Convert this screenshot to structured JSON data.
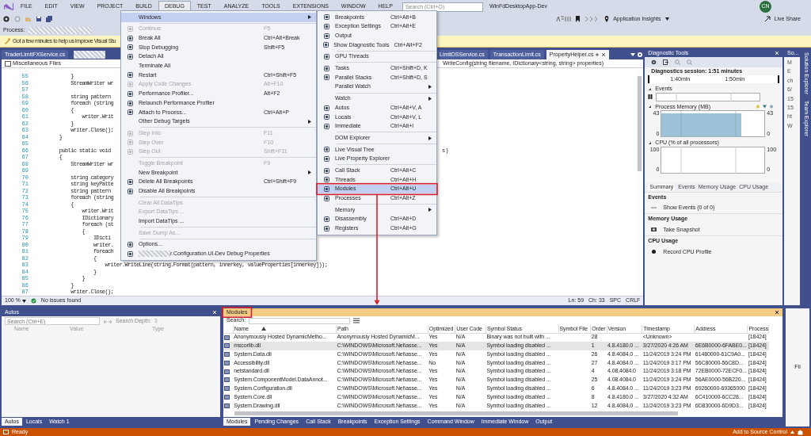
{
  "title_bar": {
    "menus": [
      {
        "label": "FILE",
        "selected": false
      },
      {
        "label": "EDIT",
        "selected": false
      },
      {
        "label": "VIEW",
        "selected": false
      },
      {
        "label": "PROJECT",
        "selected": false
      },
      {
        "label": "BUILD",
        "selected": false
      },
      {
        "label": "DEBUG",
        "selected": true
      },
      {
        "label": "TEST",
        "selected": false
      },
      {
        "label": "ANALYZE",
        "selected": false
      },
      {
        "label": "TOOLS",
        "selected": false
      },
      {
        "label": "EXTENSIONS",
        "selected": false
      },
      {
        "label": "WINDOW",
        "selected": false
      },
      {
        "label": "HELP",
        "selected": false
      }
    ],
    "search": {
      "placeholder": "Search (Ctrl+Q)"
    },
    "title": "WinFdDesktopApp-Dev",
    "user_initials": "CN",
    "live_share": "Live Share"
  },
  "toolbar": {
    "insights": "Application Insights",
    "process_label": "Process:"
  },
  "info_bar": {
    "text": "Got a few minutes to help us improve Visual Stu"
  },
  "debug_menu": {
    "items": [
      {
        "kind": "item",
        "label": "Windows",
        "submenu": true,
        "disabled": false,
        "selected": true,
        "icon": false,
        "outlined": false
      },
      {
        "kind": "separator"
      },
      {
        "kind": "item",
        "label": "Continue",
        "shortcut": "F5",
        "submenu": false,
        "disabled": true,
        "selected": false,
        "icon": true,
        "outlined": false
      },
      {
        "kind": "item",
        "label": "Break All",
        "shortcut": "Ctrl+Alt+Break",
        "submenu": false,
        "disabled": false,
        "selected": false,
        "icon": true,
        "outlined": false
      },
      {
        "kind": "item",
        "label": "Stop Debugging",
        "shortcut": "Shift+F5",
        "submenu": false,
        "disabled": false,
        "selected": false,
        "icon": true,
        "outlined": false
      },
      {
        "kind": "item",
        "label": "Detach All",
        "submenu": false,
        "disabled": false,
        "selected": false,
        "icon": true,
        "outlined": false
      },
      {
        "kind": "item",
        "label": "Terminate All",
        "submenu": false,
        "disabled": false,
        "selected": false,
        "icon": false,
        "outlined": false
      },
      {
        "kind": "item",
        "label": "Restart",
        "shortcut": "Ctrl+Shift+F5",
        "submenu": false,
        "disabled": false,
        "selected": false,
        "icon": true,
        "outlined": false
      },
      {
        "kind": "item",
        "label": "Apply Code Changes",
        "shortcut": "Alt+F10",
        "submenu": false,
        "disabled": true,
        "selected": false,
        "icon": true,
        "outlined": false
      },
      {
        "kind": "item",
        "label": "Performance Profiler...",
        "shortcut": "Alt+F2",
        "submenu": false,
        "disabled": false,
        "selected": false,
        "icon": true,
        "outlined": false
      },
      {
        "kind": "item",
        "label": "Relaunch Performance Profiler",
        "submenu": false,
        "disabled": false,
        "selected": false,
        "icon": true,
        "outlined": false
      },
      {
        "kind": "item",
        "label": "Attach to Process...",
        "shortcut": "Ctrl+Alt+P",
        "submenu": false,
        "disabled": false,
        "selected": false,
        "icon": true,
        "outlined": false
      },
      {
        "kind": "item",
        "label": "Other Debug Targets",
        "submenu": true,
        "disabled": false,
        "selected": false,
        "icon": false,
        "outlined": false
      },
      {
        "kind": "separator"
      },
      {
        "kind": "item",
        "label": "Step Into",
        "shortcut": "F11",
        "submenu": false,
        "disabled": true,
        "selected": false,
        "icon": true,
        "outlined": false
      },
      {
        "kind": "item",
        "label": "Step Over",
        "shortcut": "F10",
        "submenu": false,
        "disabled": true,
        "selected": false,
        "icon": true,
        "outlined": false
      },
      {
        "kind": "item",
        "label": "Step Out",
        "shortcut": "Shift+F11",
        "submenu": false,
        "disabled": true,
        "selected": false,
        "icon": true,
        "outlined": false
      },
      {
        "kind": "separator"
      },
      {
        "kind": "item",
        "label": "Toggle Breakpoint",
        "shortcut": "F9",
        "submenu": false,
        "disabled": true,
        "selected": false,
        "icon": false,
        "outlined": false
      },
      {
        "kind": "item",
        "label": "New Breakpoint",
        "submenu": true,
        "disabled": false,
        "selected": false,
        "icon": false,
        "outlined": false
      },
      {
        "kind": "item",
        "label": "Delete All Breakpoints",
        "shortcut": "Ctrl+Shift+F9",
        "submenu": false,
        "disabled": false,
        "selected": false,
        "icon": true,
        "outlined": false
      },
      {
        "kind": "item",
        "label": "Disable All Breakpoints",
        "submenu": false,
        "disabled": false,
        "selected": false,
        "icon": true,
        "outlined": false
      },
      {
        "kind": "separator"
      },
      {
        "kind": "item",
        "label": "Clear All DataTips",
        "submenu": false,
        "disabled": true,
        "selected": false,
        "icon": false,
        "outlined": false
      },
      {
        "kind": "item",
        "label": "Export DataTips ...",
        "submenu": false,
        "disabled": true,
        "selected": false,
        "icon": false,
        "outlined": false
      },
      {
        "kind": "item",
        "label": "Import DataTips ...",
        "submenu": false,
        "disabled": false,
        "selected": false,
        "icon": false,
        "outlined": false
      },
      {
        "kind": "separator"
      },
      {
        "kind": "item",
        "label": "Save Dump As...",
        "submenu": false,
        "disabled": true,
        "selected": false,
        "icon": false,
        "outlined": false
      },
      {
        "kind": "separator"
      },
      {
        "kind": "item",
        "label": "Options...",
        "submenu": false,
        "disabled": false,
        "selected": false,
        "icon": true,
        "outlined": false
      },
      {
        "kind": "redacted_item",
        "label": "r.Configuration.UI-Dev Debug Properties",
        "submenu": false,
        "disabled": false,
        "selected": false,
        "icon": true,
        "outlined": false
      }
    ]
  },
  "windows_menu": {
    "items": [
      {
        "kind": "item",
        "label": "Breakpoints",
        "shortcut": "Ctrl+Alt+B",
        "submenu": false,
        "disabled": false,
        "selected": false,
        "icon": true,
        "outlined": false
      },
      {
        "kind": "item",
        "label": "Exception Settings",
        "shortcut": "Ctrl+Alt+E",
        "submenu": false,
        "disabled": false,
        "selected": false,
        "icon": true,
        "outlined": false
      },
      {
        "kind": "item",
        "label": "Output",
        "submenu": false,
        "disabled": false,
        "selected": false,
        "icon": true,
        "outlined": false
      },
      {
        "kind": "item",
        "label": "Show Diagnostic Tools",
        "shortcut": "Ctrl+Alt+F2",
        "submenu": false,
        "disabled": false,
        "selected": false,
        "icon": true,
        "outlined": false
      },
      {
        "kind": "separator"
      },
      {
        "kind": "item",
        "label": "GPU Threads",
        "submenu": false,
        "disabled": false,
        "selected": false,
        "icon": true,
        "outlined": false
      },
      {
        "kind": "separator"
      },
      {
        "kind": "item",
        "label": "Tasks",
        "shortcut": "Ctrl+Shift+D, K",
        "submenu": false,
        "disabled": false,
        "selected": false,
        "icon": true,
        "outlined": false
      },
      {
        "kind": "item",
        "label": "Parallel Stacks",
        "shortcut": "Ctrl+Shift+D, S",
        "submenu": false,
        "disabled": false,
        "selected": false,
        "icon": true,
        "outlined": false
      },
      {
        "kind": "item",
        "label": "Parallel Watch",
        "submenu": true,
        "disabled": false,
        "selected": false,
        "icon": false,
        "outlined": false
      },
      {
        "kind": "separator"
      },
      {
        "kind": "item",
        "label": "Watch",
        "submenu": true,
        "disabled": false,
        "selected": false,
        "icon": false,
        "outlined": false
      },
      {
        "kind": "item",
        "label": "Autos",
        "shortcut": "Ctrl+Alt+V, A",
        "submenu": false,
        "disabled": false,
        "selected": false,
        "icon": true,
        "outlined": false
      },
      {
        "kind": "item",
        "label": "Locals",
        "shortcut": "Ctrl+Alt+V, L",
        "submenu": false,
        "disabled": false,
        "selected": false,
        "icon": true,
        "outlined": false
      },
      {
        "kind": "item",
        "label": "Immediate",
        "shortcut": "Ctrl+Alt+I",
        "submenu": false,
        "disabled": false,
        "selected": false,
        "icon": true,
        "outlined": false
      },
      {
        "kind": "separator"
      },
      {
        "kind": "item",
        "label": "DOM Explorer",
        "submenu": true,
        "disabled": false,
        "selected": false,
        "icon": false,
        "outlined": false
      },
      {
        "kind": "separator"
      },
      {
        "kind": "item",
        "label": "Live Visual Tree",
        "submenu": false,
        "disabled": false,
        "selected": false,
        "icon": true,
        "outlined": false
      },
      {
        "kind": "item",
        "label": "Live Property Explorer",
        "submenu": false,
        "disabled": false,
        "selected": false,
        "icon": true,
        "outlined": false
      },
      {
        "kind": "separator"
      },
      {
        "kind": "item",
        "label": "Call Stack",
        "shortcut": "Ctrl+Alt+C",
        "submenu": false,
        "disabled": false,
        "selected": false,
        "icon": true,
        "outlined": false
      },
      {
        "kind": "item",
        "label": "Threads",
        "shortcut": "Ctrl+Alt+H",
        "submenu": false,
        "disabled": false,
        "selected": false,
        "icon": true,
        "outlined": false
      },
      {
        "kind": "item",
        "label": "Modules",
        "shortcut": "Ctrl+Alt+U",
        "submenu": false,
        "disabled": false,
        "selected": true,
        "icon": true,
        "outlined": true
      },
      {
        "kind": "item",
        "label": "Processes",
        "shortcut": "Ctrl+Alt+Z",
        "submenu": false,
        "disabled": false,
        "selected": false,
        "icon": true,
        "outlined": false
      },
      {
        "kind": "separator"
      },
      {
        "kind": "item",
        "label": "Memory",
        "submenu": true,
        "disabled": false,
        "selected": false,
        "icon": false,
        "outlined": false
      },
      {
        "kind": "item",
        "label": "Disassembly",
        "shortcut": "Ctrl+Alt+D",
        "submenu": false,
        "disabled": false,
        "selected": false,
        "icon": true,
        "outlined": false
      },
      {
        "kind": "item",
        "label": "Registers",
        "shortcut": "Ctrl+Alt+G",
        "submenu": false,
        "disabled": false,
        "selected": false,
        "icon": true,
        "outlined": false
      }
    ]
  },
  "editor": {
    "tabs": [
      {
        "kind": "tab",
        "label": "TraderLimitFXService.cs",
        "selected": false
      },
      {
        "kind": "redacted"
      },
      {
        "kind": "tab",
        "label": "LimitDSService.cs",
        "selected": false
      },
      {
        "kind": "tab",
        "label": "TransactionLimit.cs",
        "selected": false
      },
      {
        "kind": "tab",
        "label": "PropertyHelper.cs",
        "selected": true
      }
    ],
    "file_scope": "Miscellaneous Files",
    "member": "WriteConfig(string filename, IDictionary<string, string> properties)",
    "lines": [
      {
        "n": "55",
        "text": "            }"
      },
      {
        "n": "56",
        "text": "            StreamWriter wr"
      },
      {
        "n": "57"
      },
      {
        "n": "58",
        "text": "            string pattern"
      },
      {
        "n": "59",
        "text": "            foreach (string"
      },
      {
        "n": "60",
        "text": "            {"
      },
      {
        "n": "61",
        "text": "                writer.Writ"
      },
      {
        "n": "62",
        "text": "            }"
      },
      {
        "n": "63",
        "text": "            writer.Close();"
      },
      {
        "n": "64",
        "text": "        }"
      },
      {
        "n": "65"
      },
      {
        "n": "66",
        "text": "        public static void",
        "tail": "s)"
      },
      {
        "n": "67",
        "text": "        {"
      },
      {
        "n": "68",
        "text": "            StreamWriter wr"
      },
      {
        "n": "69"
      },
      {
        "n": "70",
        "text": "            string category"
      },
      {
        "n": "71",
        "text": "            string keyPatte"
      },
      {
        "n": "72",
        "text": "            string pattern"
      },
      {
        "n": "73",
        "text": "            foreach (string"
      },
      {
        "n": "74",
        "text": "            {"
      },
      {
        "n": "75",
        "text": "                writer.Writ"
      },
      {
        "n": "76",
        "text": "                IDictionary"
      },
      {
        "n": "77",
        "text": "                foreach (st"
      },
      {
        "n": "78",
        "text": "                {"
      },
      {
        "n": "79",
        "text": "                    IDicti"
      },
      {
        "n": "80",
        "text": "                    writer."
      },
      {
        "n": "81",
        "text": "                    foreach"
      },
      {
        "n": "82",
        "text": "                    {"
      },
      {
        "n": "83",
        "text": "                        writer.WriteLine(string.Format(pattern, innerkey, valueProperties[innerkey]));"
      },
      {
        "n": "84",
        "text": "                    }"
      },
      {
        "n": "85",
        "text": "                }"
      },
      {
        "n": "86",
        "text": "            }"
      },
      {
        "n": "87",
        "text": "            writer.Close();"
      }
    ],
    "zoom": "100 %",
    "issues": "No issues found",
    "position": [
      "Ln: 59",
      "Ch: 33",
      "SPC",
      "CRLF"
    ]
  },
  "diagnostics": {
    "title": "Diagnostic Tools",
    "session": "Diagnostics session: 1:51 minutes",
    "ticks": [
      "1:40min",
      "1:50min"
    ],
    "events_label": "Events",
    "memory_label": "Process Memory (MB)",
    "memory_axis_left": {
      "max": "43",
      "min": "0"
    },
    "memory_axis_right": {
      "max": "43",
      "min": "0"
    },
    "cpu_label": "CPU (% of all processors)",
    "cpu_axis_left": {
      "max": "100",
      "min": "0"
    },
    "cpu_axis_right": {
      "max": "100",
      "min": "0"
    },
    "tabs": [
      {
        "label": "Summary",
        "selected": true
      },
      {
        "label": "Events",
        "selected": false
      },
      {
        "label": "Memory Usage",
        "selected": false
      },
      {
        "label": "CPU Usage",
        "selected": false
      }
    ],
    "sections": [
      {
        "heading": "Events",
        "action": "Show Events (0 of 0)"
      },
      {
        "heading": "Memory Usage",
        "action": "Take Snapshot"
      },
      {
        "heading": "CPU Usage",
        "action": "Record CPU Profile"
      }
    ]
  },
  "solution": {
    "header": "So...",
    "fragments": [
      "M",
      "E",
      "ch",
      "6/",
      "15",
      "15",
      "ht",
      "W"
    ],
    "side_tabs": [
      "Solution Explorer",
      "Team Explorer"
    ],
    "bottom_fragment": "Fil"
  },
  "autos": {
    "title": "Autos",
    "search_placeholder": "Search (Ctrl+E)",
    "depth_label": "Search Depth:",
    "depth": "3",
    "columns": [
      "Name",
      "Value",
      "Type"
    ],
    "tabs": [
      {
        "label": "Autos",
        "selected": true
      },
      {
        "label": "Locals",
        "selected": false
      },
      {
        "label": "Watch 1",
        "selected": false
      }
    ]
  },
  "modules": {
    "title": "Modules",
    "outlined": true,
    "search_label": "Search:",
    "columns": [
      {
        "label": "Name",
        "sorted": true
      },
      {
        "label": "Path",
        "sorted": false
      },
      {
        "label": "Optimized",
        "sorted": false
      },
      {
        "label": "User Code",
        "sorted": false
      },
      {
        "label": "Symbol Status",
        "sorted": false
      },
      {
        "label": "Symbol File",
        "sorted": false
      },
      {
        "label": "Order",
        "sorted": false
      },
      {
        "label": "Version",
        "sorted": false
      },
      {
        "label": "Timestamp",
        "sorted": false
      },
      {
        "label": "Address",
        "sorted": false
      },
      {
        "label": "Process",
        "sorted": false
      }
    ],
    "rows": [
      {
        "selected": false,
        "cells": [
          "Anonymously Hosted DynamicMetho...",
          "Anonymously Hosted DynamicM...",
          "Yes",
          "N/A",
          "Binary was not built with ...",
          "",
          "28",
          "",
          "<Unknown>",
          "",
          "[18424]"
        ]
      },
      {
        "selected": true,
        "cells": [
          "mscorlib.dll",
          "C:\\WINDOWS\\Microsoft.Net\\asse...",
          "Yes",
          "N/A",
          "Symbol loading disabled ...",
          "",
          "1",
          "4.8.4180.0 ...",
          "3/27/2020 4:26 AM",
          "6E6B0000-6FABE0...",
          "[18424]"
        ]
      },
      {
        "selected": false,
        "cells": [
          "System.Data.dll",
          "C:\\WINDOWS\\Microsoft.Net\\asse...",
          "Yes",
          "N/A",
          "Symbol loading disabled ...",
          "",
          "26",
          "4.8.4084.0 ...",
          "11/24/2019 3:24 PM",
          "61480000-61C9A0...",
          "[18424]"
        ]
      },
      {
        "selected": false,
        "cells": [
          "Accessibility.dll",
          "C:\\WINDOWS\\Microsoft.Net\\asse...",
          "No",
          "N/A",
          "Symbol loading disabled ...",
          "",
          "27",
          "4.8.4084.0 ...",
          "11/24/2019 3:17 PM",
          "56C80000-56C8D...",
          "[18424]"
        ]
      },
      {
        "selected": false,
        "cells": [
          "netstandard.dll",
          "C:\\WINDOWS\\Microsoft.Net\\asse...",
          "Yes",
          "N/A",
          "Symbol loading disabled ...",
          "",
          "4",
          "4.08.4084.0",
          "11/24/2019 3:18 PM",
          "72EB0000-72ECF0...",
          "[18424]"
        ]
      },
      {
        "selected": false,
        "cells": [
          "System.ComponentModel.DataAnnot...",
          "C:\\WINDOWS\\Microsoft.Net\\asse...",
          "Yes",
          "N/A",
          "Symbol loading disabled ...",
          "",
          "25",
          "4.08.4084.0",
          "11/24/2019 3:24 PM",
          "56AE0000-56B220...",
          "[18424]"
        ]
      },
      {
        "selected": false,
        "cells": [
          "System.Configuration.dll",
          "C:\\WINDOWS\\Microsoft.Net\\asse...",
          "Yes",
          "N/A",
          "Symbol loading disabled ...",
          "",
          "6",
          "4.8.4084.0 ...",
          "11/24/2019 3:23 PM",
          "69260000-69365000",
          "[18424]"
        ]
      },
      {
        "selected": false,
        "cells": [
          "System.Core.dll",
          "C:\\WINDOWS\\Microsoft.Net\\asse...",
          "Yes",
          "N/A",
          "Symbol loading disabled ...",
          "",
          "8",
          "4.8.4180.0 ...",
          "3/27/2020 4:32 AM",
          "6C410000-6CC28...",
          "[18424]"
        ]
      },
      {
        "selected": false,
        "cells": [
          "System.Drawing.dll",
          "C:\\WINDOWS\\Microsoft.Net\\asse...",
          "Yes",
          "N/A",
          "Symbol loading disabled ...",
          "",
          "12",
          "4.8.4084.0 ...",
          "11/24/2019 3:23 PM",
          "6D830000-6D9D3...",
          "[18424]"
        ]
      }
    ],
    "tabs": [
      {
        "label": "Modules",
        "selected": true
      },
      {
        "label": "Pending Changes",
        "selected": false
      },
      {
        "label": "Call Stack",
        "selected": false
      },
      {
        "label": "Breakpoints",
        "selected": false
      },
      {
        "label": "Exception Settings",
        "selected": false
      },
      {
        "label": "Command Window",
        "selected": false
      },
      {
        "label": "Immediate Window",
        "selected": false
      },
      {
        "label": "Output",
        "selected": false
      }
    ]
  },
  "status_bar": {
    "text": "Ready",
    "source_control": "Add to Source Control"
  }
}
